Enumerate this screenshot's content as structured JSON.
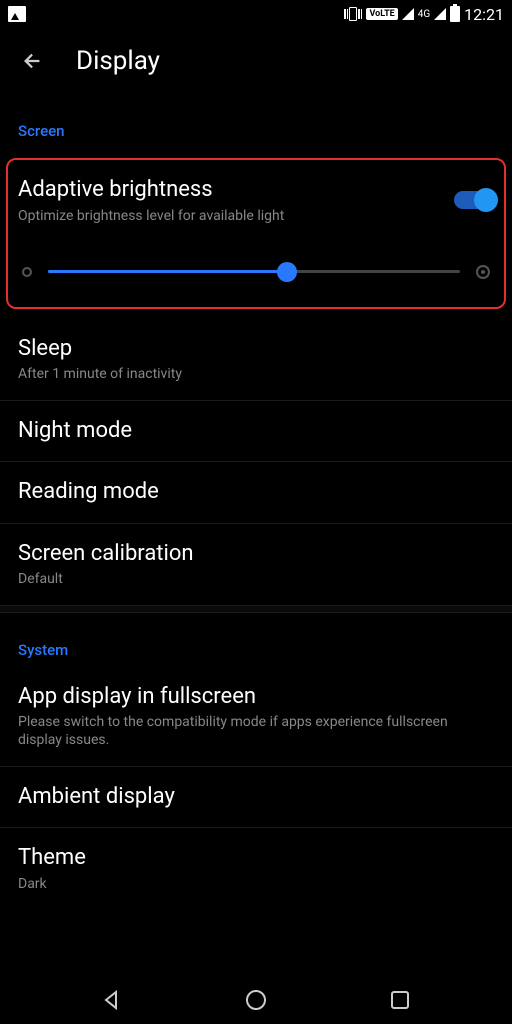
{
  "status": {
    "volte": "VoLTE",
    "network": "4G",
    "time": "12:21"
  },
  "header": {
    "title": "Display"
  },
  "sections": {
    "screen": {
      "label": "Screen",
      "adaptive": {
        "title": "Adaptive brightness",
        "subtitle": "Optimize brightness level for available light",
        "toggle": true,
        "slider_percent": 58
      },
      "sleep": {
        "title": "Sleep",
        "subtitle": "After 1 minute of inactivity"
      },
      "night": {
        "title": "Night mode"
      },
      "reading": {
        "title": "Reading mode"
      },
      "calibration": {
        "title": "Screen calibration",
        "subtitle": "Default"
      }
    },
    "system": {
      "label": "System",
      "fullscreen": {
        "title": "App display in fullscreen",
        "subtitle": "Please switch to the compatibility mode if apps experience fullscreen display issues."
      },
      "ambient": {
        "title": "Ambient display"
      },
      "theme": {
        "title": "Theme",
        "subtitle": "Dark"
      }
    }
  }
}
